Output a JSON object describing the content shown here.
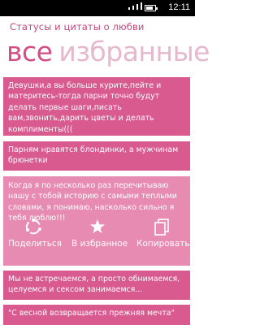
{
  "status_bar": {
    "clock": "12:11",
    "signal_icon": "signal-icon",
    "battery_icon": "battery-icon"
  },
  "app": {
    "title": "Статусы и цитаты о любви"
  },
  "pivot": {
    "active": "все",
    "inactive": "избранные"
  },
  "cards": [
    {
      "text": "Девушки,а вы больше курите,пейте и материтесь-тогда парни точно будут делать первые шаги,писать вам,звонить,дарить цветы и делать комплименты((("
    },
    {
      "text": "Парням нравятся блондинки, а мужчинам брюнетки"
    },
    {
      "text": "Когда я по несколько раз перечитываю нашу с тобой историю с самыми теплыми словами, я понимаю, насколько сильно я тебя люблю!!!"
    },
    {
      "text": "Мы не встречаемся, а просто обнимаемся, целуемся и сексом занимаемся..."
    },
    {
      "text": "\"С весной возвращается прежняя мечта\""
    }
  ],
  "actions": {
    "share_label": "Поделиться",
    "share_icon": "share-icon",
    "favorite_label": "В избранное",
    "favorite_icon": "star-add-icon",
    "copy_label": "Копировать",
    "copy_icon": "copy-icon"
  },
  "colors": {
    "accent": "#d24e86",
    "card": "#d85a8f",
    "card_selected": "#e78bb2"
  }
}
